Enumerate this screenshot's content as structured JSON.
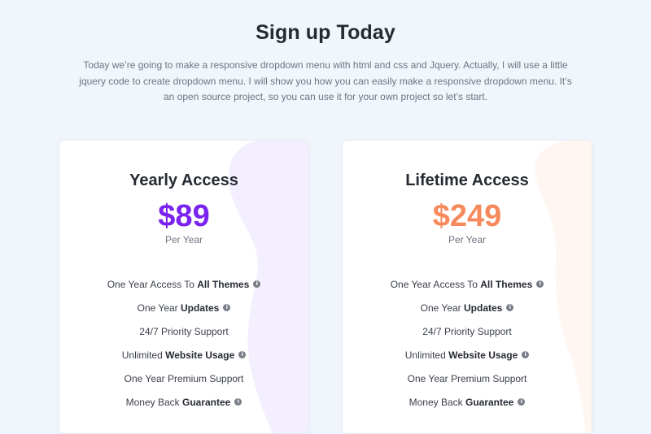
{
  "header": {
    "title": "Sign up Today",
    "description": "Today we’re going to make a responsive dropdown menu with html and css and Jquery. Actually, I will use a little jquery code to create dropdown menu. I will show you how you can easily make a responsive dropdown menu. It’s an open source project, so you can use it for your own project so let’s start."
  },
  "plans": {
    "yearly": {
      "title": "Yearly Access",
      "price": "$89",
      "period": "Per Year",
      "accent_color": "#7a22f0",
      "features": [
        {
          "prefix": "One Year Access To ",
          "bold": "All Themes",
          "info": true
        },
        {
          "prefix": "One Year ",
          "bold": "Updates",
          "info": true
        },
        {
          "prefix": "24/7 Priority Support",
          "bold": "",
          "info": false
        },
        {
          "prefix": "Unlimited ",
          "bold": "Website Usage",
          "info": true
        },
        {
          "prefix": "One Year Premium Support",
          "bold": "",
          "info": false
        },
        {
          "prefix": "Money Back ",
          "bold": "Guarantee",
          "info": true
        }
      ]
    },
    "lifetime": {
      "title": "Lifetime Access",
      "price": "$249",
      "period": "Per Year",
      "accent_color": "#f78a5c",
      "features": [
        {
          "prefix": "One Year Access To ",
          "bold": "All Themes",
          "info": true
        },
        {
          "prefix": "One Year ",
          "bold": "Updates",
          "info": true
        },
        {
          "prefix": "24/7 Priority Support",
          "bold": "",
          "info": false
        },
        {
          "prefix": "Unlimited ",
          "bold": "Website Usage",
          "info": true
        },
        {
          "prefix": "One Year Premium Support",
          "bold": "",
          "info": false
        },
        {
          "prefix": "Money Back ",
          "bold": "Guarantee",
          "info": true
        }
      ]
    }
  },
  "icons": {
    "info": "info-icon"
  },
  "colors": {
    "background": "#f1f6fd",
    "yearly_blob": "#f4efff",
    "lifetime_blob": "#fff6f1"
  }
}
